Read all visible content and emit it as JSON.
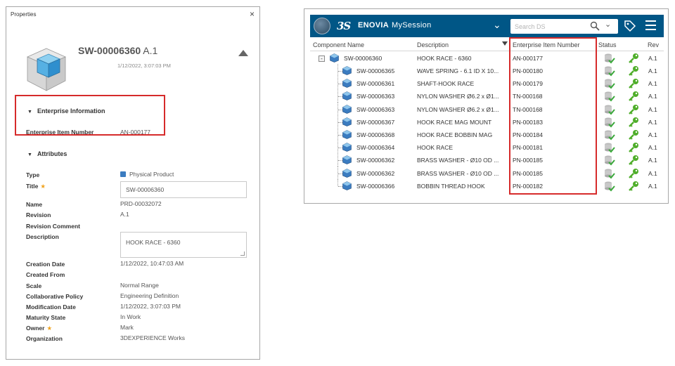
{
  "properties": {
    "window_title": "Properties",
    "close_glyph": "×",
    "item_name": "SW-00006360",
    "item_revision": "A.1",
    "item_datetime": "1/12/2022, 3:07:03 PM",
    "enterprise_section": {
      "heading": "Enterprise Information",
      "label": "Enterprise Item Number",
      "value": "AN-000177"
    },
    "attributes_heading": "Attributes",
    "type_label": "Type",
    "type_value": "Physical Product",
    "title_label": "Title",
    "title_value": "SW-00006360",
    "name_label": "Name",
    "name_value": "PRD-00032072",
    "revision_label": "Revision",
    "revision_value": "A.1",
    "revision_comment_label": "Revision Comment",
    "description_label": "Description",
    "description_value": "HOOK RACE - 6360",
    "creation_date_label": "Creation Date",
    "creation_date_value": "1/12/2022, 10:47:03 AM",
    "created_from_label": "Created From",
    "scale_label": "Scale",
    "scale_value": "Normal Range",
    "policy_label": "Collaborative Policy",
    "policy_value": "Engineering Definition",
    "modification_date_label": "Modification Date",
    "modification_date_value": "1/12/2022, 3:07:03 PM",
    "maturity_label": "Maturity State",
    "maturity_value": "In Work",
    "owner_label": "Owner",
    "owner_value": "Mark",
    "organization_label": "Organization",
    "organization_value": "3DEXPERIENCE Works",
    "required_star": "★"
  },
  "enovia": {
    "brand": "ENOVIA",
    "session": "MySession",
    "ds_logo": "3S",
    "search_placeholder": "Search DS",
    "columns": {
      "component": "Component Name",
      "description": "Description",
      "ein": "Enterprise Item Number",
      "status": "Status",
      "rev": "Rev"
    },
    "root": {
      "name": "SW-00006360",
      "description": "HOOK RACE - 6360",
      "ein": "AN-000177",
      "rev": "A.1"
    },
    "rows": [
      {
        "name": "SW-00006365",
        "description": "WAVE SPRING - 6.1 ID X 10...",
        "ein": "PN-000180",
        "rev": "A.1"
      },
      {
        "name": "SW-00006361",
        "description": "SHAFT-HOOK RACE",
        "ein": "PN-000179",
        "rev": "A.1"
      },
      {
        "name": "SW-00006363",
        "description": "NYLON WASHER Ø6.2 x Ø1...",
        "ein": "TN-000168",
        "rev": "A.1"
      },
      {
        "name": "SW-00006363",
        "description": "NYLON WASHER Ø6.2 x Ø1...",
        "ein": "TN-000168",
        "rev": "A.1"
      },
      {
        "name": "SW-00006367",
        "description": "HOOK RACE MAG MOUNT",
        "ein": "PN-000183",
        "rev": "A.1"
      },
      {
        "name": "SW-00006368",
        "description": "HOOK RACE BOBBIN MAG",
        "ein": "PN-000184",
        "rev": "A.1"
      },
      {
        "name": "SW-00006364",
        "description": "HOOK RACE",
        "ein": "PN-000181",
        "rev": "A.1"
      },
      {
        "name": "SW-00006362",
        "description": "BRASS WASHER - Ø10 OD ...",
        "ein": "PN-000185",
        "rev": "A.1"
      },
      {
        "name": "SW-00006362",
        "description": "BRASS WASHER - Ø10 OD ...",
        "ein": "PN-000185",
        "rev": "A.1"
      },
      {
        "name": "SW-00006366",
        "description": "BOBBIN THREAD HOOK",
        "ein": "PN-000182",
        "rev": "A.1"
      }
    ]
  },
  "colors": {
    "highlight_box": "#d62b2b",
    "topbar": "#005686",
    "star": "#f0a21c",
    "part_icon": "#3b7cc0",
    "status_check": "#3aa83a",
    "key": "#4fae2a"
  }
}
